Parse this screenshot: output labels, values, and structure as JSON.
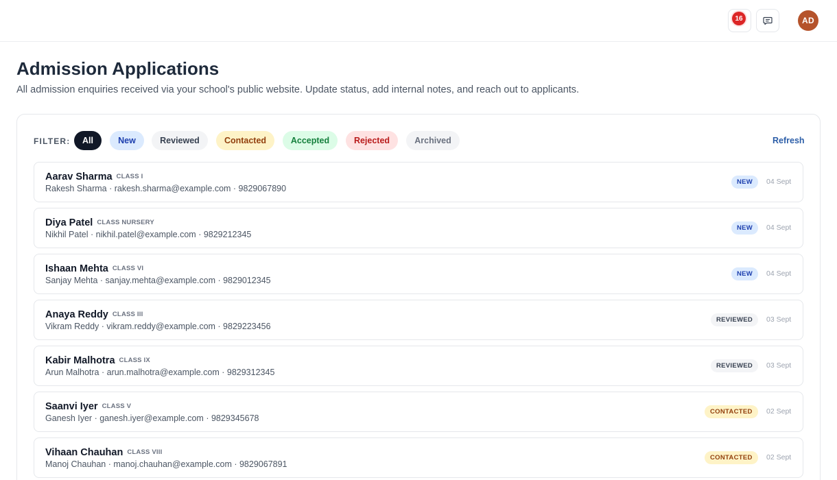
{
  "topbar": {
    "notification_count": "16",
    "avatar_initials": "AD"
  },
  "page": {
    "title": "Admission Applications",
    "subtitle": "All admission enquiries received via your school's public website. Update status, add internal notes, and reach out to applicants."
  },
  "filter": {
    "label": "FILTER:",
    "refresh_label": "Refresh",
    "chips": [
      {
        "label": "All",
        "bg": "#111827",
        "fg": "#ffffff",
        "active": true
      },
      {
        "label": "New",
        "bg": "#dbeafe",
        "fg": "#1e40af"
      },
      {
        "label": "Reviewed",
        "bg": "#f3f4f6",
        "fg": "#374151"
      },
      {
        "label": "Contacted",
        "bg": "#fef3c7",
        "fg": "#92400e"
      },
      {
        "label": "Accepted",
        "bg": "#dcfce7",
        "fg": "#15803d"
      },
      {
        "label": "Rejected",
        "bg": "#fee2e2",
        "fg": "#b91c1c"
      },
      {
        "label": "Archived",
        "bg": "#f3f4f6",
        "fg": "#6b7280"
      }
    ]
  },
  "status_colors": {
    "NEW": {
      "bg": "#dbeafe",
      "fg": "#1e40af"
    },
    "REVIEWED": {
      "bg": "#f3f4f6",
      "fg": "#374151"
    },
    "CONTACTED": {
      "bg": "#fef3c7",
      "fg": "#92400e"
    }
  },
  "applications": [
    {
      "name": "Aarav Sharma",
      "class": "CLASS I",
      "contact": "Rakesh Sharma · rakesh.sharma@example.com · 9829067890",
      "status": "NEW",
      "date": "04 Sept"
    },
    {
      "name": "Diya Patel",
      "class": "CLASS NURSERY",
      "contact": "Nikhil Patel · nikhil.patel@example.com · 9829212345",
      "status": "NEW",
      "date": "04 Sept"
    },
    {
      "name": "Ishaan Mehta",
      "class": "CLASS VI",
      "contact": "Sanjay Mehta · sanjay.mehta@example.com · 9829012345",
      "status": "NEW",
      "date": "04 Sept"
    },
    {
      "name": "Anaya Reddy",
      "class": "CLASS III",
      "contact": "Vikram Reddy · vikram.reddy@example.com · 9829223456",
      "status": "REVIEWED",
      "date": "03 Sept"
    },
    {
      "name": "Kabir Malhotra",
      "class": "CLASS IX",
      "contact": "Arun Malhotra · arun.malhotra@example.com · 9829312345",
      "status": "REVIEWED",
      "date": "03 Sept"
    },
    {
      "name": "Saanvi Iyer",
      "class": "CLASS V",
      "contact": "Ganesh Iyer · ganesh.iyer@example.com · 9829345678",
      "status": "CONTACTED",
      "date": "02 Sept"
    },
    {
      "name": "Vihaan Chauhan",
      "class": "CLASS VIII",
      "contact": "Manoj Chauhan · manoj.chauhan@example.com · 9829067891",
      "status": "CONTACTED",
      "date": "02 Sept"
    }
  ]
}
